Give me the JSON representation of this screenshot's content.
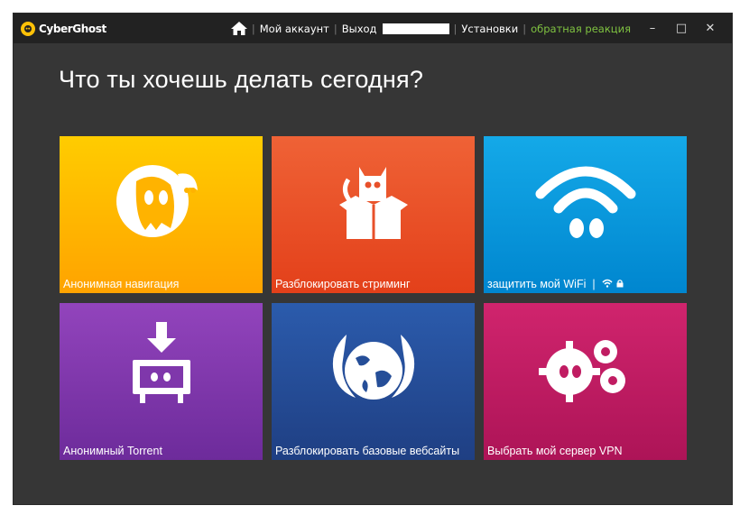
{
  "app": {
    "logo_text": "CyberGhost"
  },
  "nav": {
    "account": "Мой аккаунт",
    "logout": "Выход",
    "settings": "Установки",
    "feedback": "обратная реакция"
  },
  "window_controls": {
    "minimize": "–",
    "maximize": "□",
    "close": "✕"
  },
  "main": {
    "heading": "Что ты хочешь делать сегодня?",
    "tiles": [
      {
        "label": "Анонимная навигация",
        "icon": "ghost-icon",
        "color": "#ffb300"
      },
      {
        "label": "Разблокировать стриминг",
        "icon": "cat-box-icon",
        "color": "#e8502a"
      },
      {
        "label": "защитить мой WiFi",
        "icon": "wifi-icon",
        "color": "#0a98de"
      },
      {
        "label": "Анонимный Torrent",
        "icon": "torrent-download-icon",
        "color": "#7f37ab"
      },
      {
        "label": "Разблокировать базовые вебсайты",
        "icon": "globe-wings-icon",
        "color": "#254e98"
      },
      {
        "label": "Выбрать мой сервер VPN",
        "icon": "gears-icon",
        "color": "#c01c62"
      }
    ]
  },
  "colors": {
    "background": "#363636",
    "titlebar": "#222222",
    "feedback": "#7fc241"
  }
}
